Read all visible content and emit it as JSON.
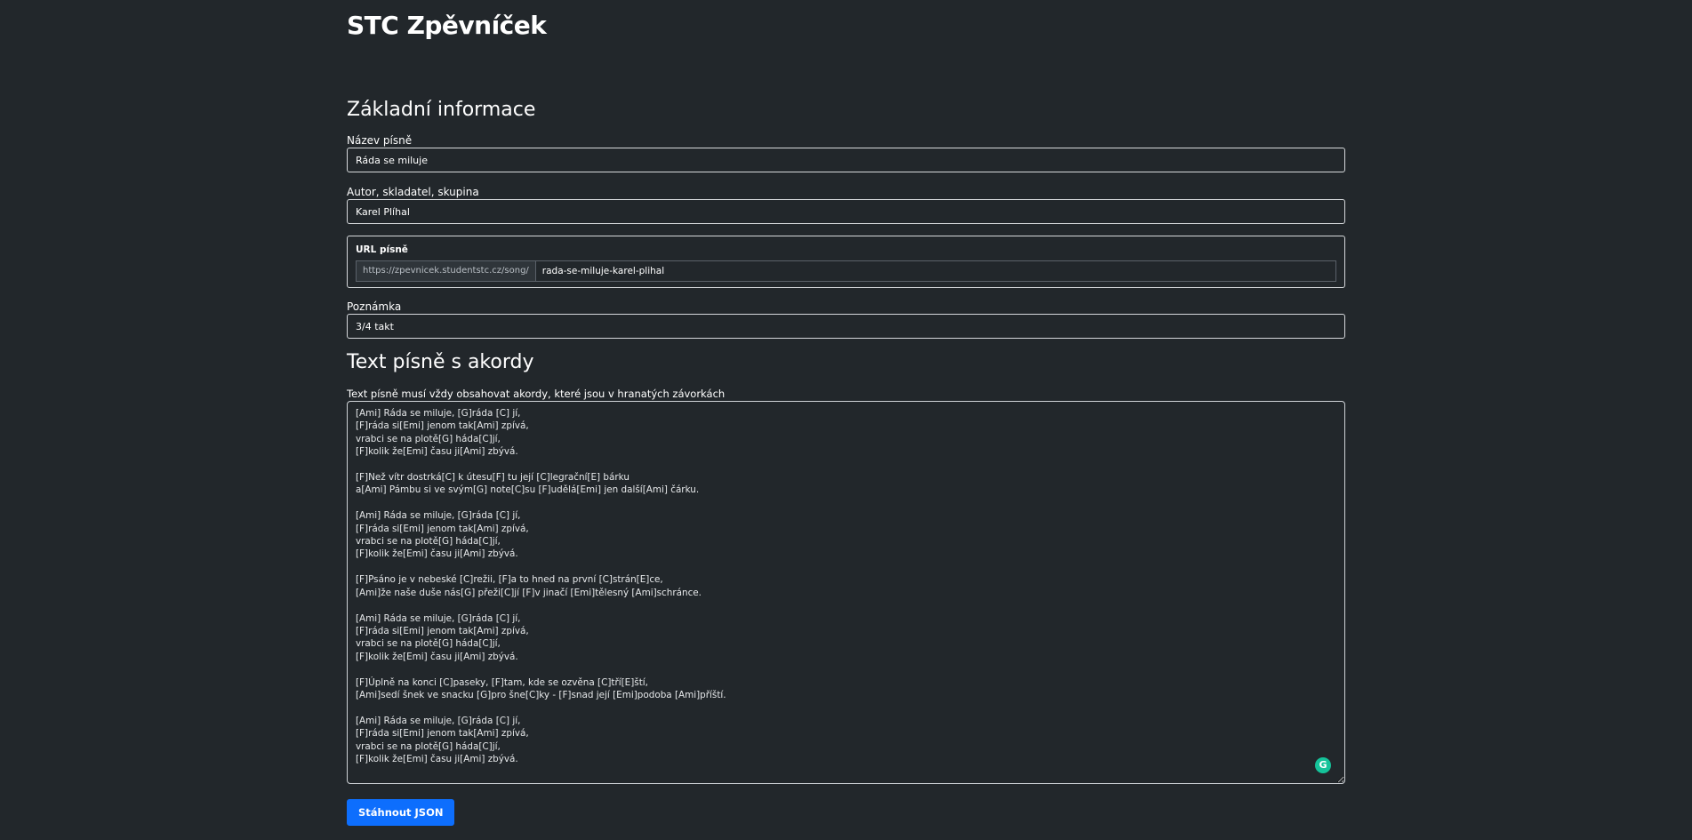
{
  "app": {
    "title": "STC Zpěvníček"
  },
  "basic_info": {
    "heading": "Základní informace",
    "song_name": {
      "label": "Název písně",
      "value": "Ráda se miluje"
    },
    "author": {
      "label": "Autor, skladatel, skupina",
      "value": "Karel Plíhal"
    },
    "url": {
      "label": "URL písně",
      "prefix": "https://zpevnicek.studentstc.cz/song/",
      "value": "rada-se-miluje-karel-plihal"
    },
    "note": {
      "label": "Poznámka",
      "value": "3/4 takt"
    }
  },
  "lyrics": {
    "heading": "Text písně s akordy",
    "help": "Text písně musí vždy obsahovat akordy, které jsou v hranatých závorkách",
    "value": "[Ami] Ráda se miluje, [G]ráda [C] jí,\n[F]ráda si[Emi] jenom tak[Ami] zpívá,\nvrabci se na plotě[G] háda[C]jí,\n[F]kolik že[Emi] času ji[Ami] zbývá.\n\n[F]Než vítr dostrká[C] k útesu[F] tu její [C]legrační[E] bárku\na[Ami] Pámbu si ve svým[G] note[C]su [F]udělá[Emi] jen další[Ami] čárku.\n\n[Ami] Ráda se miluje, [G]ráda [C] jí,\n[F]ráda si[Emi] jenom tak[Ami] zpívá,\nvrabci se na plotě[G] háda[C]jí,\n[F]kolik že[Emi] času ji[Ami] zbývá.\n\n[F]Psáno je v nebeské [C]režii, [F]a to hned na první [C]strán[E]ce,\n[Ami]že naše duše nás[G] přeži[C]jí [F]v jinačí [Emi]tělesný [Ami]schránce.\n\n[Ami] Ráda se miluje, [G]ráda [C] jí,\n[F]ráda si[Emi] jenom tak[Ami] zpívá,\nvrabci se na plotě[G] háda[C]jí,\n[F]kolik že[Emi] času ji[Ami] zbývá.\n\n[F]Úplně na konci [C]paseky, [F]tam, kde se ozvěna [C]tří[E]ští,\n[Ami]sedí šnek ve snacku [G]pro šne[C]ky - [F]snad její [Emi]podoba [Ami]příští.\n\n[Ami] Ráda se miluje, [G]ráda [C] jí,\n[F]ráda si[Emi] jenom tak[Ami] zpívá,\nvrabci se na plotě[G] háda[C]jí,\n[F]kolik že[Emi] času ji[Ami] zbývá."
  },
  "actions": {
    "download_label": "Stáhnout JSON"
  },
  "icons": {
    "grammarly": "grammarly-icon",
    "grammarly_color": "#15c39a"
  },
  "colors": {
    "background": "#22272b",
    "accent": "#0d6efd"
  }
}
